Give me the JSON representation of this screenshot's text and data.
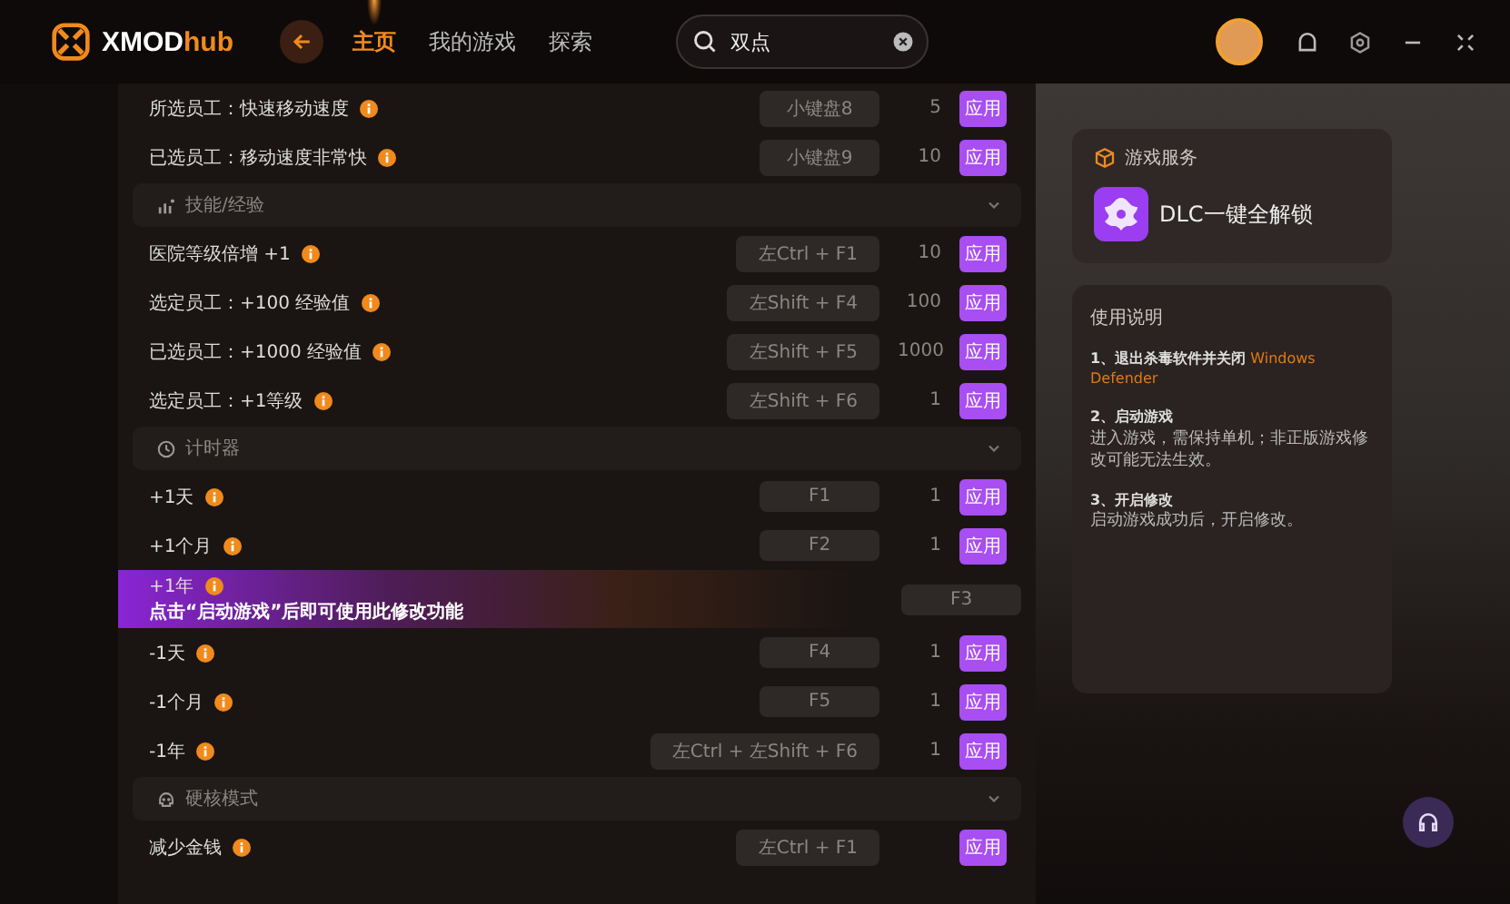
{
  "header": {
    "logo": [
      "XMOD",
      "hub"
    ],
    "nav": [
      {
        "label": "主页",
        "selected": true
      },
      {
        "label": "我的游戏",
        "selected": false
      },
      {
        "label": "探索",
        "selected": false
      }
    ],
    "search": {
      "value": "双点"
    }
  },
  "groups": [
    {
      "rows": [
        {
          "kind": "normal",
          "label": "所选员工：快速移动速度",
          "key": "小键盘8",
          "count": "5",
          "button": "应用"
        },
        {
          "kind": "normal",
          "label": "已选员工：移动速度非常快",
          "key": "小键盘9",
          "count": "10",
          "button": "应用"
        }
      ]
    },
    {
      "title": "技能/经验",
      "expanded": true,
      "rows": [
        {
          "kind": "normal",
          "label": "医院等级倍增 +1",
          "key": "左Ctrl + F1",
          "count": "10",
          "button": "应用"
        },
        {
          "kind": "normal",
          "label": "选定员工：+100 经验值",
          "key": "左Shift + F4",
          "count": "100",
          "button": "应用"
        },
        {
          "kind": "normal",
          "label": "已选员工：+1000 经验值",
          "key": "左Shift + F5",
          "count": "1000",
          "button": "应用"
        },
        {
          "kind": "normal",
          "label": "选定员工：+1等级",
          "key": "左Shift + F6",
          "count": "1",
          "button": "应用"
        }
      ]
    },
    {
      "title": "计时器",
      "expanded": true,
      "rows": [
        {
          "kind": "normal",
          "label": "+1天",
          "key": "F1",
          "count": "1",
          "button": "应用"
        },
        {
          "kind": "normal",
          "label": "+1个月",
          "key": "F2",
          "count": "1",
          "button": "应用"
        },
        {
          "kind": "locked",
          "label": "+1年",
          "hint": "点击“启动游戏”后即可使用此修改功能",
          "key": "F3"
        },
        {
          "kind": "normal",
          "label": "-1天",
          "key": "F4",
          "count": "1",
          "button": "应用"
        },
        {
          "kind": "normal",
          "label": "-1个月",
          "key": "F5",
          "count": "1",
          "button": "应用"
        },
        {
          "kind": "normal",
          "label": "-1年",
          "key": "左Ctrl + 左Shift + F6",
          "count": "1",
          "button": "应用"
        }
      ]
    },
    {
      "title": "硬核模式",
      "expanded": true,
      "rows": [
        {
          "kind": "normal",
          "label": "减少金钱",
          "key": "左Ctrl + F1",
          "button": "应用"
        }
      ]
    }
  ],
  "services": {
    "title": "游戏服务",
    "item": "DLC一键全解锁"
  },
  "instructions": {
    "title": "使用说明",
    "steps": [
      {
        "title": "1、退出杀毒软件并关闭",
        "highlight": "Windows Defender"
      },
      {
        "title": "2、启动游戏",
        "body": "进入游戏，需保持单机；非正版游戏修改可能无法生效。"
      },
      {
        "title": "3、开启修改",
        "body": "启动游戏成功后，开启修改。"
      }
    ]
  }
}
